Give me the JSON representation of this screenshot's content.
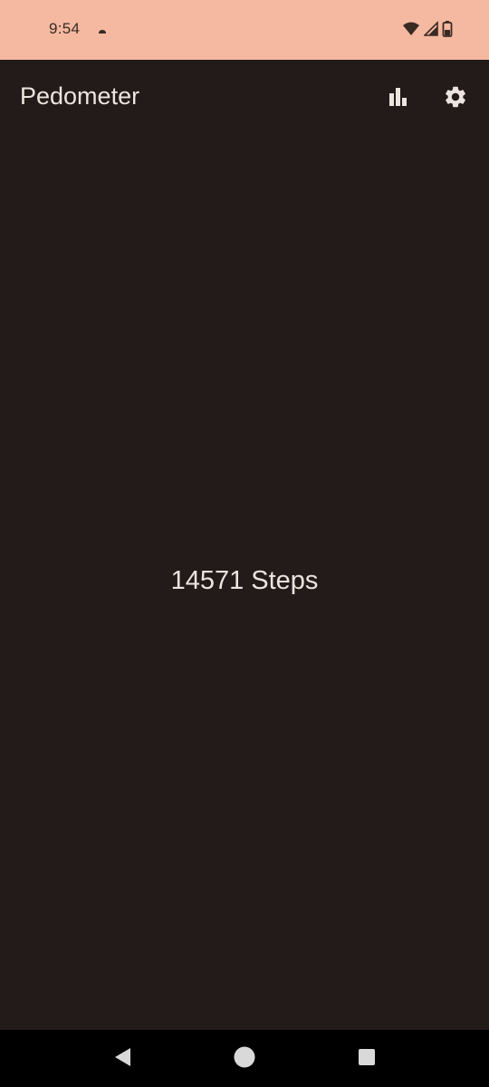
{
  "status_bar": {
    "time": "9:54",
    "notification_icon": "cloud-icon",
    "wifi_icon": "wifi-icon",
    "signal_icon": "cell-signal-icon",
    "battery_icon": "battery-icon",
    "background_color": "#f4b9a0"
  },
  "app_bar": {
    "title": "Pedometer",
    "actions": [
      {
        "icon": "bar-chart-icon"
      },
      {
        "icon": "gear-icon"
      }
    ]
  },
  "main": {
    "steps_text": "14571 Steps",
    "background_color": "#231b19"
  },
  "nav_bar": {
    "buttons": [
      {
        "icon": "back-icon"
      },
      {
        "icon": "home-icon"
      },
      {
        "icon": "recents-icon"
      }
    ]
  }
}
